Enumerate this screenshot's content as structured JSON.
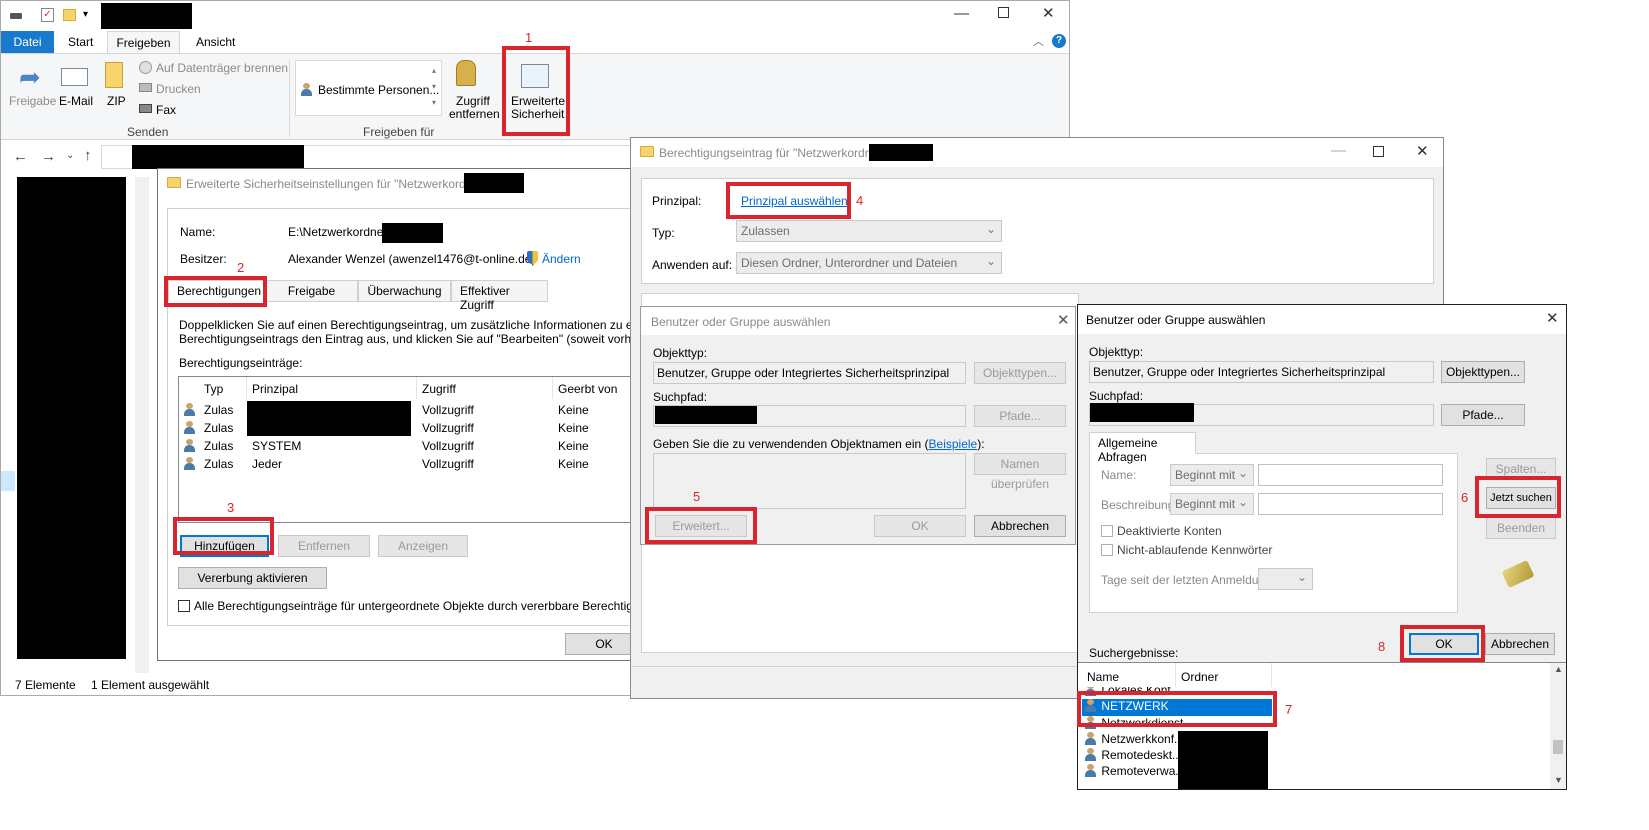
{
  "explorer": {
    "qat_hidden": "",
    "tabs": [
      "Datei",
      "Start",
      "Freigeben",
      "Ansicht"
    ],
    "ribbon": {
      "freigabe": "Freigabe",
      "email": "E-Mail",
      "zip": "ZIP",
      "brennen": "Auf Datenträger brennen",
      "drucken": "Drucken",
      "fax": "Fax",
      "senden_group": "Senden",
      "bestimmte": "Bestimmte Personen...",
      "zugriff_line1": "Zugriff",
      "zugriff_line2": "entfernen",
      "erw_line1": "Erweiterte",
      "erw_line2": "Sicherheit",
      "freigeben_group": "Freigeben für"
    },
    "status": {
      "count": "7 Elemente",
      "selected": "1 Element ausgewählt"
    }
  },
  "adv_dialog": {
    "title": "Erweiterte Sicherheitseinstellungen für \"Netzwerkordner",
    "name_label": "Name:",
    "name_value": "E:\\Netzwerkordner",
    "owner_label": "Besitzer:",
    "owner_value": "Alexander Wenzel (awenzel1476@t-online.de)",
    "change": "Ändern",
    "tabs": [
      "Berechtigungen",
      "Freigabe",
      "Überwachung",
      "Effektiver Zugriff"
    ],
    "info1": "Doppelklicken Sie auf einen Berechtigungseintrag, um zusätzliche Informationen zu erhalt",
    "info2": "Berechtigungseintrags den Eintrag aus, und klicken Sie auf \"Bearbeiten\" (soweit vorhande",
    "entries_label": "Berechtigungseinträge:",
    "columns": [
      "Typ",
      "Prinzipal",
      "Zugriff",
      "Geerbt von"
    ],
    "rows": [
      {
        "typ": "Zulas",
        "prinzipal": "",
        "zugriff": "Vollzugriff",
        "geerbt": "Keine"
      },
      {
        "typ": "Zulas",
        "prinzipal": "",
        "zugriff": "Vollzugriff",
        "geerbt": "Keine"
      },
      {
        "typ": "Zulas",
        "prinzipal": "SYSTEM",
        "zugriff": "Vollzugriff",
        "geerbt": "Keine"
      },
      {
        "typ": "Zulas",
        "prinzipal": "Jeder",
        "zugriff": "Vollzugriff",
        "geerbt": "Keine"
      }
    ],
    "add": "Hinzufügen",
    "remove": "Entfernen",
    "view": "Anzeigen",
    "inherit": "Vererbung aktivieren",
    "replace": "Alle Berechtigungseinträge für untergeordnete Objekte durch vererbbare Berechtigungs",
    "ok": "OK"
  },
  "entry_dialog": {
    "title": "Berechtigungseintrag für \"Netzwerkordne",
    "principal_label": "Prinzipal:",
    "principal_link": "Prinzipal auswählen",
    "type_label": "Typ:",
    "type_value": "Zulassen",
    "apply_label": "Anwenden auf:",
    "apply_value": "Diesen Ordner, Unterordner und Dateien"
  },
  "select_small": {
    "title": "Benutzer oder Gruppe auswählen",
    "objtype_label": "Objekttyp:",
    "objtype_value": "Benutzer, Gruppe oder Integriertes Sicherheitsprinzipal",
    "objtype_btn": "Objekttypen...",
    "path_label": "Suchpfad:",
    "path_btn": "Pfade...",
    "names_label_pre": "Geben Sie die zu verwendenden Objektnamen ein (",
    "names_link": "Beispiele",
    "names_label_post": "):",
    "check_btn": "Namen überprüfen",
    "advanced": "Erweitert...",
    "ok": "OK",
    "cancel": "Abbrechen"
  },
  "select_adv": {
    "title": "Benutzer oder Gruppe auswählen",
    "objtype_label": "Objekttyp:",
    "objtype_value": "Benutzer, Gruppe oder Integriertes Sicherheitsprinzipal",
    "objtype_btn": "Objekttypen...",
    "path_label": "Suchpfad:",
    "path_btn": "Pfade...",
    "tab": "Allgemeine Abfragen",
    "name_label": "Name:",
    "desc_label": "Beschreibung:",
    "begins": "Beginnt mit",
    "disabled_accounts": "Deaktivierte Konten",
    "nonexp": "Nicht-ablaufende Kennwörter",
    "days_label": "Tage seit der letzten Anmeldung:",
    "columns_btn": "Spalten...",
    "search_btn": "Jetzt suchen",
    "stop_btn": "Beenden",
    "results_label": "Suchergebnisse:",
    "ok": "OK",
    "cancel": "Abbrechen",
    "result_cols": [
      "Name",
      "Ordner"
    ],
    "results": [
      "Lokales Kont...",
      "NETZWERK",
      "Netzwerkdienst",
      "Netzwerkkonf...",
      "Remotedeskt...",
      "Remoteverwa..."
    ]
  },
  "steps": [
    "1",
    "2",
    "3",
    "4",
    "5",
    "6",
    "7",
    "8"
  ],
  "colors": {
    "accent": "#0078d7",
    "highlight": "#d9262e",
    "selected_row": "#0078d7"
  }
}
